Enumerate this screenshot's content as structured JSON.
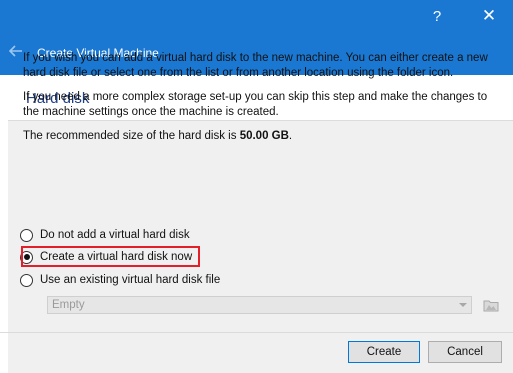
{
  "window": {
    "title": "Create Virtual Machine",
    "help_glyph": "?",
    "close_glyph": "✕"
  },
  "page": {
    "heading": "Hard disk",
    "paragraph1": "If you wish you can add a virtual hard disk to the new machine. You can either create a new hard disk file or select one from the list or from another location using the folder icon.",
    "paragraph2": "If you need a more complex storage set-up you can skip this step and make the changes to the machine settings once the machine is created.",
    "recommended_prefix": "The recommended size of the hard disk is ",
    "recommended_size": "50.00 GB",
    "recommended_suffix": "."
  },
  "options": {
    "no_disk": "Do not add a virtual hard disk",
    "create_now": "Create a virtual hard disk now",
    "use_existing": "Use an existing virtual hard disk file",
    "selected": "create_now"
  },
  "existing_file": {
    "value": "Empty"
  },
  "buttons": {
    "create": "Create",
    "cancel": "Cancel"
  },
  "colors": {
    "titlebar": "#1a78d2",
    "highlight": "#e3202a",
    "heading": "#1e3f8a"
  },
  "icons": {
    "back": "back-arrow-icon",
    "folder": "folder-icon",
    "help": "help-icon",
    "close": "close-icon"
  }
}
